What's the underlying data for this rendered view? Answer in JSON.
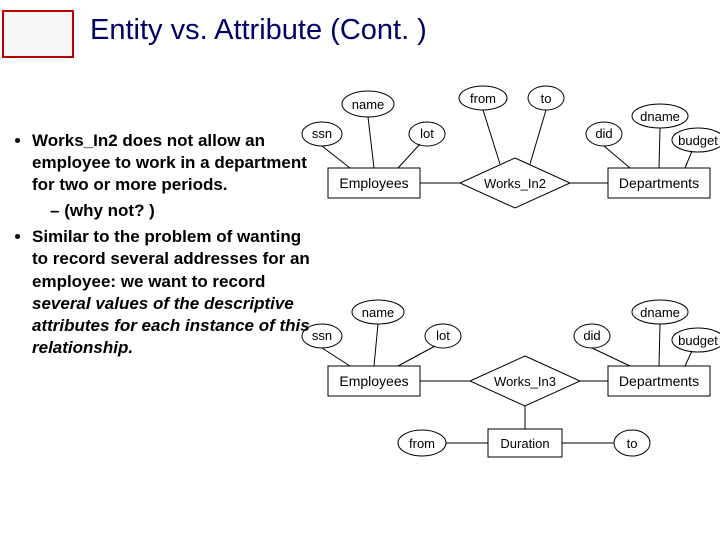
{
  "title": "Entity vs. Attribute (Cont. )",
  "bullets": {
    "item1_a": "Works_In2 does not allow an employee to work in a department for two or more periods.",
    "item1_sub": "(why not? )",
    "item2_a": "Similar to the problem   of wanting to record several addresses for an employee:  we want to record ",
    "item2_b": "several values of the descriptive attributes for each instance of this relationship."
  },
  "d1": {
    "ssn": "ssn",
    "name": "name",
    "lot": "lot",
    "from": "from",
    "to": "to",
    "did": "did",
    "dname": "dname",
    "budget": "budget",
    "employees": "Employees",
    "works_in": "Works_In2",
    "departments": "Departments"
  },
  "d2": {
    "ssn": "ssn",
    "name": "name",
    "lot": "lot",
    "did": "did",
    "dname": "dname",
    "budget": "budget",
    "employees": "Employees",
    "works_in": "Works_In3",
    "departments": "Departments",
    "duration": "Duration",
    "from": "from",
    "to": "to"
  }
}
